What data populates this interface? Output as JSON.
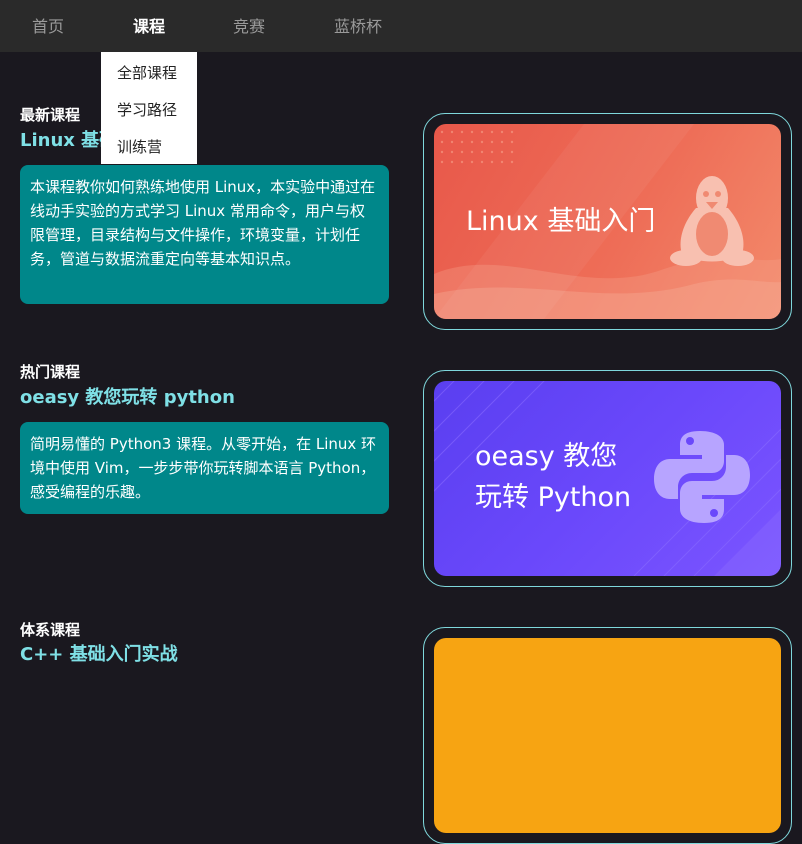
{
  "nav": {
    "items": [
      "首页",
      "课程",
      "竞赛",
      "蓝桥杯"
    ],
    "active": "课程"
  },
  "dropdown": {
    "items": [
      "全部课程",
      "学习路径",
      "训练营"
    ]
  },
  "sections": [
    {
      "label": "最新课程",
      "title": "Linux 基础入门",
      "description": "本课程教你如何熟练地使用 Linux，本实验中通过在线动手实验的方式学习 Linux 常用命令，用户与权限管理，目录结构与文件操作，环境变量，计划任务，管道与数据流重定向等基本知识点。",
      "card": {
        "line1": "Linux 基础入门",
        "line2": "",
        "color_start": "#e8584a",
        "color_end": "#f38a6b",
        "icon": "tux-penguin-icon"
      }
    },
    {
      "label": "热门课程",
      "title": "oeasy 教您玩转 python",
      "description": "简明易懂的 Python3 课程。从零开始，在 Linux 环境中使用 Vim，一步步带你玩转脚本语言 Python，感受编程的乐趣。",
      "card": {
        "line1": "oeasy 教您",
        "line2": "玩转 Python",
        "color_start": "#5a3ff0",
        "color_end": "#7b55ff",
        "icon": "python-logo-icon"
      }
    },
    {
      "label": "体系课程",
      "title": "C++ 基础入门实战",
      "card": {
        "color_start": "#f7a412",
        "color_end": "#f7a412"
      }
    }
  ]
}
